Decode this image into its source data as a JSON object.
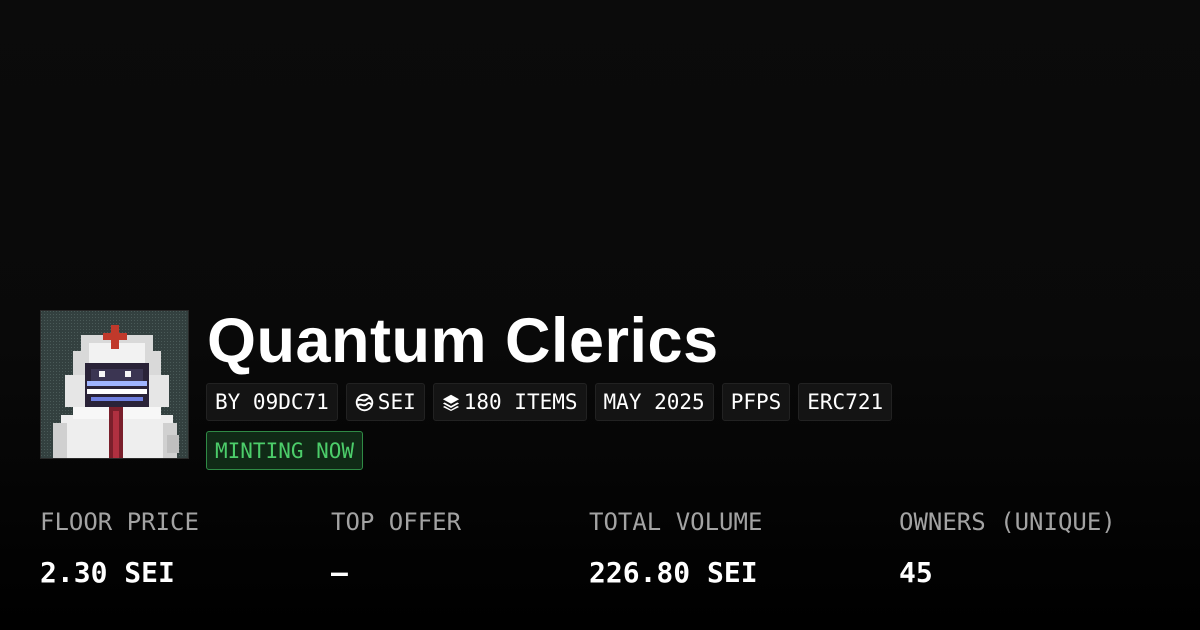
{
  "collection": {
    "name": "Quantum Clerics",
    "image_alt": "pixel-art cleric avatar"
  },
  "tags": [
    {
      "label": "BY 09DC71",
      "icon": null
    },
    {
      "label": "SEI",
      "icon": "sei-logo-icon"
    },
    {
      "label": "180 ITEMS",
      "icon": "layers-icon"
    },
    {
      "label": "MAY 2025",
      "icon": null
    },
    {
      "label": "PFPS",
      "icon": null
    },
    {
      "label": "ERC721",
      "icon": null
    }
  ],
  "status": {
    "label": "MINTING NOW",
    "color": "#4ccd6a"
  },
  "stats": [
    {
      "label": "FLOOR PRICE",
      "value": "2.30 SEI"
    },
    {
      "label": "TOP OFFER",
      "value": "–"
    },
    {
      "label": "TOTAL VOLUME",
      "value": "226.80 SEI"
    },
    {
      "label": "OWNERS (UNIQUE)",
      "value": "45"
    }
  ],
  "colors": {
    "background": "#0a0a0a",
    "accent_green": "#4ccd6a",
    "muted_text": "#a3a3a3"
  }
}
